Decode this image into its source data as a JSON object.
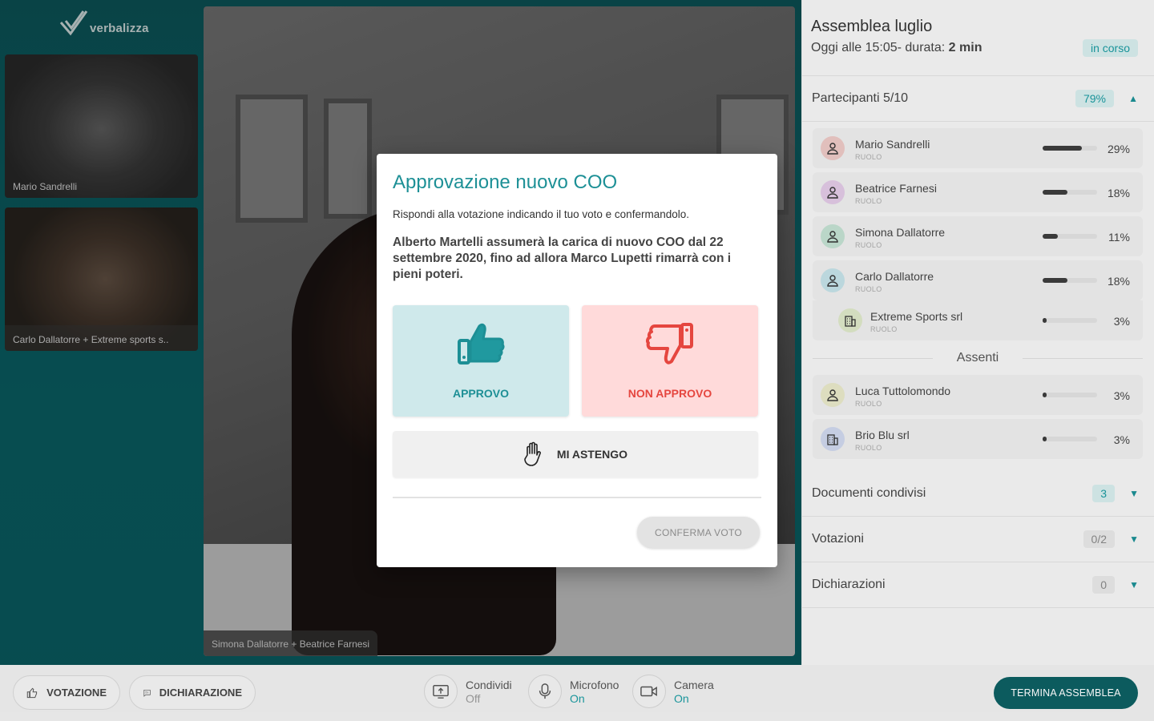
{
  "brand": {
    "name": "verbalizza"
  },
  "videos": {
    "tile1_caption": "Mario Sandrelli",
    "tile2_caption": "Carlo Dallatorre + Extreme sports s..",
    "main_caption": "Simona Dallatorre + Beatrice Farnesi"
  },
  "meeting": {
    "title": "Assemblea luglio",
    "schedule": "Oggi alle 15:05- durata:",
    "duration": "2 min",
    "status": "in corso",
    "status_color": "#1b9aa0"
  },
  "participants": {
    "header": "Partecipanti 5/10",
    "percent": "79%",
    "role_label": "RUOLO",
    "present": [
      {
        "name": "Mario Sandrelli",
        "percent": "29%",
        "share": 0.29,
        "color": "#e87c72"
      },
      {
        "name": "Beatrice Farnesi",
        "percent": "18%",
        "share": 0.18,
        "color": "#c77fd3"
      },
      {
        "name": "Simona Dallatorre",
        "percent": "11%",
        "share": 0.11,
        "color": "#6cc49a"
      },
      {
        "name": "Carlo Dallatorre",
        "percent": "18%",
        "share": 0.18,
        "color": "#6ec6d8"
      },
      {
        "name": "Extreme Sports srl",
        "percent": "3%",
        "share": 0.03,
        "color": "#b9d97a"
      }
    ],
    "absent_header": "Assenti",
    "absent": [
      {
        "name": "Luca Tuttolomondo",
        "percent": "3%",
        "share": 0.03,
        "color": "#d7da7a"
      },
      {
        "name": "Brio Blu srl",
        "percent": "3%",
        "share": 0.03,
        "color": "#8fa7ea"
      }
    ]
  },
  "sections": [
    {
      "label": "Documenti condivisi",
      "count": "3"
    },
    {
      "label": "Votazioni",
      "count": "0/2"
    },
    {
      "label": "Dichiarazioni",
      "count": "0"
    }
  ],
  "toolbar": {
    "vote_label": "VOTAZIONE",
    "declaration_label": "DICHIARAZIONE",
    "share_label": "Condividi",
    "share_state": "Off",
    "mic_label": "Microfono",
    "mic_state": "On",
    "camera_label": "Camera",
    "camera_state": "On",
    "end_label": "TERMINA ASSEMBLEA"
  },
  "modal": {
    "title": "Approvazione nuovo COO",
    "intro": "Rispondi alla votazione indicando il tuo voto e confermandolo.",
    "question": "Alberto Martelli assumerà la carica di nuovo COO dal 22 settembre 2020, fino ad allora Marco Lupetti rimarrà con i pieni poteri.",
    "approve_label": "APPROVO",
    "reject_label": "NON APPROVO",
    "abstain_label": "MI ASTENGO",
    "confirm_label": "CONFERMA VOTO"
  }
}
